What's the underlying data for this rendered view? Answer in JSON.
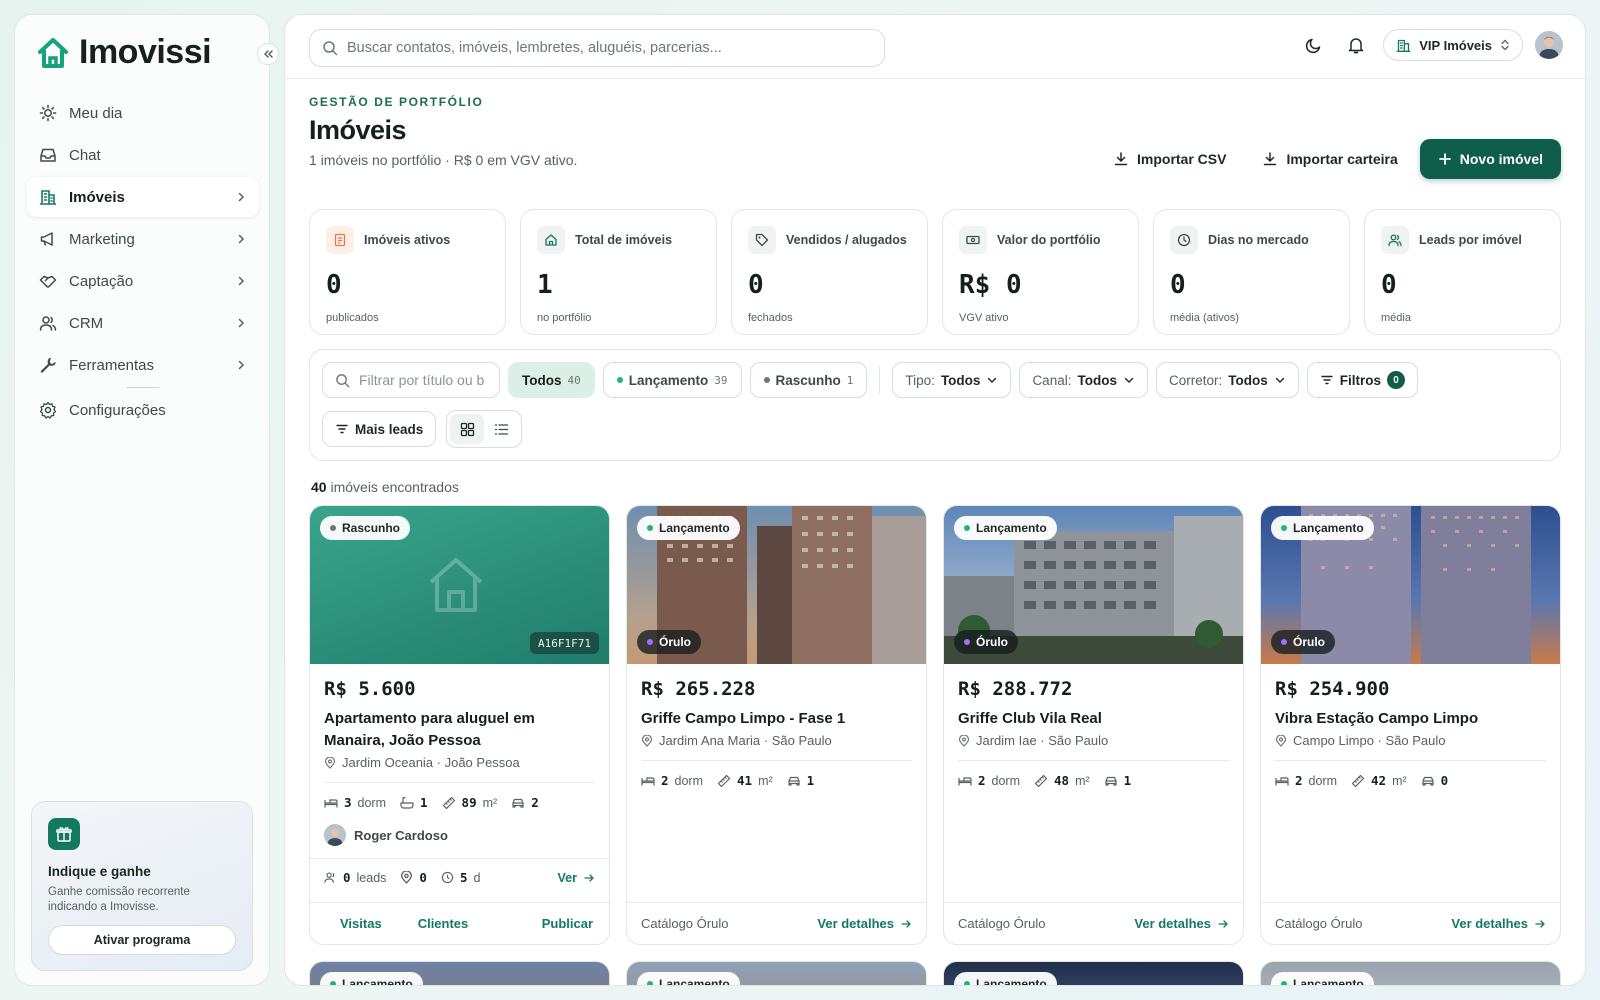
{
  "app": {
    "name": "Imovissi"
  },
  "sidebar": {
    "items": [
      {
        "label": "Meu dia"
      },
      {
        "label": "Chat"
      },
      {
        "label": "Imóveis"
      },
      {
        "label": "Marketing"
      },
      {
        "label": "Captação"
      },
      {
        "label": "CRM"
      },
      {
        "label": "Ferramentas"
      },
      {
        "label": "Configurações"
      }
    ],
    "promo": {
      "title": "Indique e ganhe",
      "text": "Ganhe comissão recorrente indicando a Imovisse.",
      "button": "Ativar programa"
    }
  },
  "topbar": {
    "search_placeholder": "Buscar contatos, imóveis, lembretes, aluguéis, parcerias...",
    "org": "VIP Imóveis"
  },
  "header": {
    "eyebrow": "GESTÃO DE PORTFÓLIO",
    "title": "Imóveis",
    "subtitle": "1 imóveis no portfólio · R$  0 em VGV ativo.",
    "import_csv": "Importar CSV",
    "import_portfolio": "Importar carteira",
    "new_property": "Novo imóvel"
  },
  "stats": [
    {
      "label": "Imóveis ativos",
      "value": "0",
      "sub": "publicados",
      "icon": "list-icon",
      "color": "#fdeee6"
    },
    {
      "label": "Total de imóveis",
      "value": "1",
      "sub": "no portfólio",
      "icon": "home-icon",
      "color": "#f0f3f2"
    },
    {
      "label": "Vendidos / alugados",
      "value": "0",
      "sub": "fechados",
      "icon": "tag-icon",
      "color": "#f0f3f2"
    },
    {
      "label": "Valor do portfólio",
      "value": "R$ 0",
      "sub": "VGV ativo",
      "icon": "money-icon",
      "color": "#f0f3f2"
    },
    {
      "label": "Dias no mercado",
      "value": "0",
      "sub": "média (ativos)",
      "icon": "clock-icon",
      "color": "#f0f3f2"
    },
    {
      "label": "Leads por imóvel",
      "value": "0",
      "sub": "média",
      "icon": "users-icon",
      "color": "#f0f3f2"
    }
  ],
  "filters": {
    "search_placeholder": "Filtrar por título ou b",
    "status": [
      {
        "label": "Todos",
        "count": "40"
      },
      {
        "label": "Lançamento",
        "count": "39"
      },
      {
        "label": "Rascunho",
        "count": "1"
      }
    ],
    "tipo": {
      "label": "Tipo:",
      "value": "Todos"
    },
    "canal": {
      "label": "Canal:",
      "value": "Todos"
    },
    "corretor": {
      "label": "Corretor:",
      "value": "Todos"
    },
    "more": {
      "label": "Filtros",
      "count": "0"
    },
    "sort": "Mais leads"
  },
  "results": {
    "count": "40",
    "label": "imóveis encontrados"
  },
  "cards": [
    {
      "status": "Rascunho",
      "code": "A16F1F71",
      "price": "R$ 5.600",
      "title": "Apartamento para aluguel em Manaira, João Pessoa",
      "location": "Jardim Oceania · João Pessoa",
      "dorm": "3",
      "dorm_label": "dorm",
      "bath": "1",
      "area": "89",
      "area_unit": "m²",
      "parking": "2",
      "agent": "Roger Cardoso",
      "leads": "0",
      "leads_label": "leads",
      "views": "0",
      "days": "5",
      "days_unit": "d",
      "see": "Ver",
      "actions": [
        "Visitas",
        "Clientes",
        "Publicar"
      ]
    },
    {
      "status": "Lançamento",
      "source": "Órulo",
      "price": "R$ 265.228",
      "title": "Griffe Campo Limpo - Fase 1",
      "location": "Jardim Ana Maria · São Paulo",
      "dorm": "2",
      "dorm_label": "dorm",
      "area": "41",
      "area_unit": "m²",
      "parking": "1",
      "catalog": "Catálogo Órulo",
      "details": "Ver detalhes"
    },
    {
      "status": "Lançamento",
      "source": "Órulo",
      "price": "R$ 288.772",
      "title": "Griffe Club Vila Real",
      "location": "Jardim Iae · São Paulo",
      "dorm": "2",
      "dorm_label": "dorm",
      "area": "48",
      "area_unit": "m²",
      "parking": "1",
      "catalog": "Catálogo Órulo",
      "details": "Ver detalhes"
    },
    {
      "status": "Lançamento",
      "source": "Órulo",
      "price": "R$ 254.900",
      "title": "Vibra Estação Campo Limpo",
      "location": "Campo Limpo · São Paulo",
      "dorm": "2",
      "dorm_label": "dorm",
      "area": "42",
      "area_unit": "m²",
      "parking": "0",
      "catalog": "Catálogo Órulo",
      "details": "Ver detalhes"
    }
  ],
  "cards_row2": [
    {
      "status": "Lançamento"
    },
    {
      "status": "Lançamento"
    },
    {
      "status": "Lançamento"
    },
    {
      "status": "Lançamento"
    }
  ],
  "colors": {
    "brand": "#0f5e49",
    "accent": "#137a5f",
    "launch_dot": "#22b573",
    "orulo_dot": "#a66cff"
  }
}
